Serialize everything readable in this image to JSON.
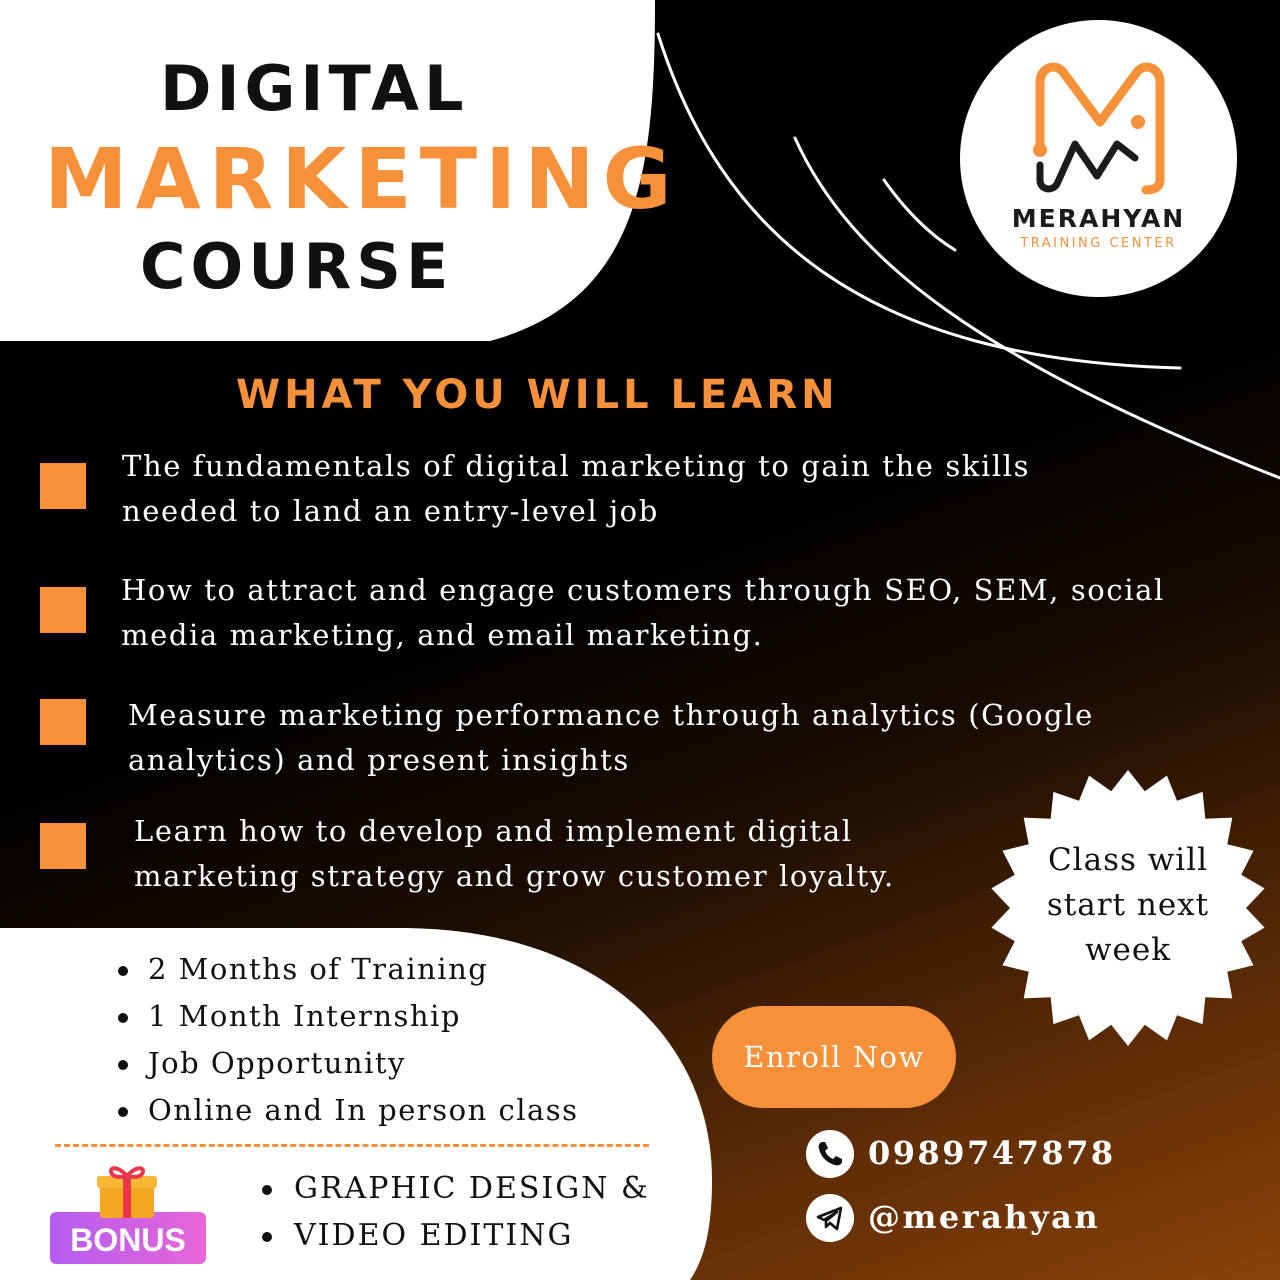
{
  "title": {
    "line1": "DIGITAL",
    "line2": "MARKETING",
    "line3": "COURSE"
  },
  "logo": {
    "name": "MERAHYAN",
    "subtitle": "TRAINING CENTER"
  },
  "learn": {
    "heading": "WHAT YOU WILL LEARN",
    "items": [
      {
        "line1": "The fundamentals of digital marketing to gain the skills",
        "line2": "needed to land an entry-level job"
      },
      {
        "line1": "How to attract and engage customers through SEO, SEM, social",
        "line2": "media marketing, and email marketing."
      },
      {
        "line1": "Measure marketing performance through analytics (Google",
        "line2": "analytics) and present insights"
      },
      {
        "line1": "Learn how to develop and implement digital",
        "line2": "marketing strategy and grow customer loyalty."
      }
    ]
  },
  "badge": {
    "lines": [
      "Class will",
      "start next",
      "week"
    ]
  },
  "features": [
    "2 Months of Training",
    "1 Month Internship",
    "Job Opportunity",
    "Online and In person class"
  ],
  "bonus": {
    "label": "BONUS",
    "items": [
      "GRAPHIC DESIGN &",
      "VIDEO EDITING"
    ]
  },
  "cta": {
    "label": "Enroll Now"
  },
  "contact": {
    "phone": "0989747878",
    "telegram": "@merahyan"
  },
  "icons": {
    "logo": "merahyan-m-logo-icon",
    "bullet": "orange-square-icon",
    "gift": "gift-box-icon",
    "phone": "phone-icon",
    "telegram": "telegram-icon"
  },
  "colors": {
    "accent": "#f6913a",
    "dark": "#000000",
    "light": "#ffffff",
    "bonus_gradient_start": "#b55cf0",
    "bonus_gradient_end": "#e766d8"
  }
}
